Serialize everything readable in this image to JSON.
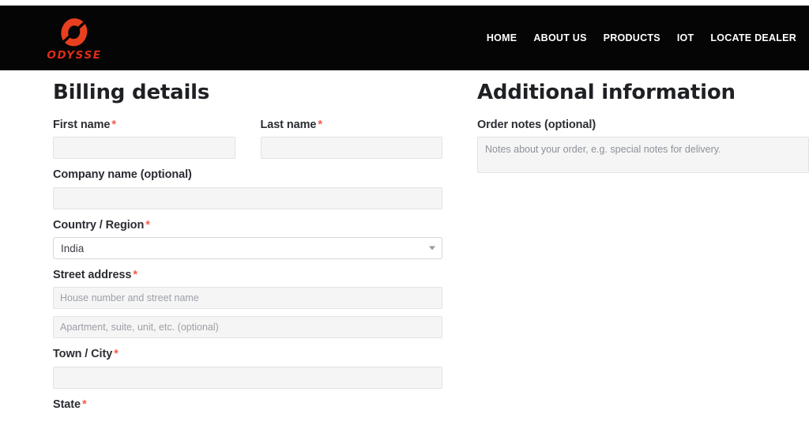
{
  "header": {
    "logo": {
      "mark_icon": "odysse-o-logo-icon",
      "wordmark": "ODYSSE",
      "mark_color": "#e8401f",
      "word_color": "#e02b18",
      "background": "#050505"
    },
    "nav": [
      {
        "label": "HOME",
        "name": "nav-item-home"
      },
      {
        "label": "ABOUT US",
        "name": "nav-item-about-us"
      },
      {
        "label": "PRODUCTS",
        "name": "nav-item-products"
      },
      {
        "label": "IOT",
        "name": "nav-item-iot"
      },
      {
        "label": "LOCATE DEALER",
        "name": "nav-item-locate-dealer"
      }
    ]
  },
  "billing": {
    "title": "Billing details",
    "required_mark": "*",
    "first_name": {
      "label": "First name",
      "value": "",
      "placeholder": ""
    },
    "last_name": {
      "label": "Last name",
      "value": "",
      "placeholder": ""
    },
    "company_name": {
      "label": "Company name (optional)",
      "value": "",
      "placeholder": ""
    },
    "country_region": {
      "label": "Country / Region",
      "selected": "India",
      "arrow_icon": "chevron-down-icon"
    },
    "street_address": {
      "label": "Street address",
      "line1_placeholder": "House number and street name",
      "line1_value": "",
      "line2_placeholder": "Apartment, suite, unit, etc. (optional)",
      "line2_value": ""
    },
    "town_city": {
      "label": "Town / City",
      "value": "",
      "placeholder": ""
    },
    "state": {
      "label": "State"
    }
  },
  "additional": {
    "title": "Additional information",
    "order_notes": {
      "label": "Order notes (optional)",
      "placeholder": "Notes about your order, e.g. special notes for delivery.",
      "value": ""
    }
  },
  "colors": {
    "required_asterisk": "#fb5a4d",
    "input_background": "#f5f5f5",
    "input_border": "#e3e3e3",
    "text_primary": "#2b2d33",
    "heading": "#1f2024"
  }
}
